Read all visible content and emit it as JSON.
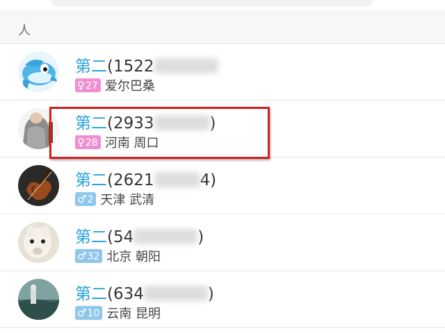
{
  "section": {
    "title": "人"
  },
  "contacts": [
    {
      "nick": "第二",
      "id_visible": "(1522",
      "id_tail": "",
      "gender_icon": "♀",
      "gender": "female",
      "age": "27",
      "location": "爱尔巴桑"
    },
    {
      "nick": "第二",
      "id_visible": "(2933",
      "id_tail": ")",
      "gender_icon": "♀",
      "gender": "female",
      "age": "28",
      "location": "河南 周口"
    },
    {
      "nick": "第二",
      "id_visible": "(2621",
      "id_tail": "4)",
      "gender_icon": "♂",
      "gender": "male",
      "age": "2",
      "location": "天津 武清"
    },
    {
      "nick": "第二",
      "id_visible": "(54",
      "id_tail": ")",
      "gender_icon": "♂",
      "gender": "male",
      "age": "32",
      "location": "北京 朝阳"
    },
    {
      "nick": "第二",
      "id_visible": "(634",
      "id_tail": ")",
      "gender_icon": "♂",
      "gender": "male",
      "age": "10",
      "location": "云南 昆明"
    }
  ],
  "colors": {
    "nick": "#2aa3dc",
    "female_badge": "#f08fcf",
    "male_badge": "#8fc6ec",
    "highlight": "#d71d1d"
  }
}
